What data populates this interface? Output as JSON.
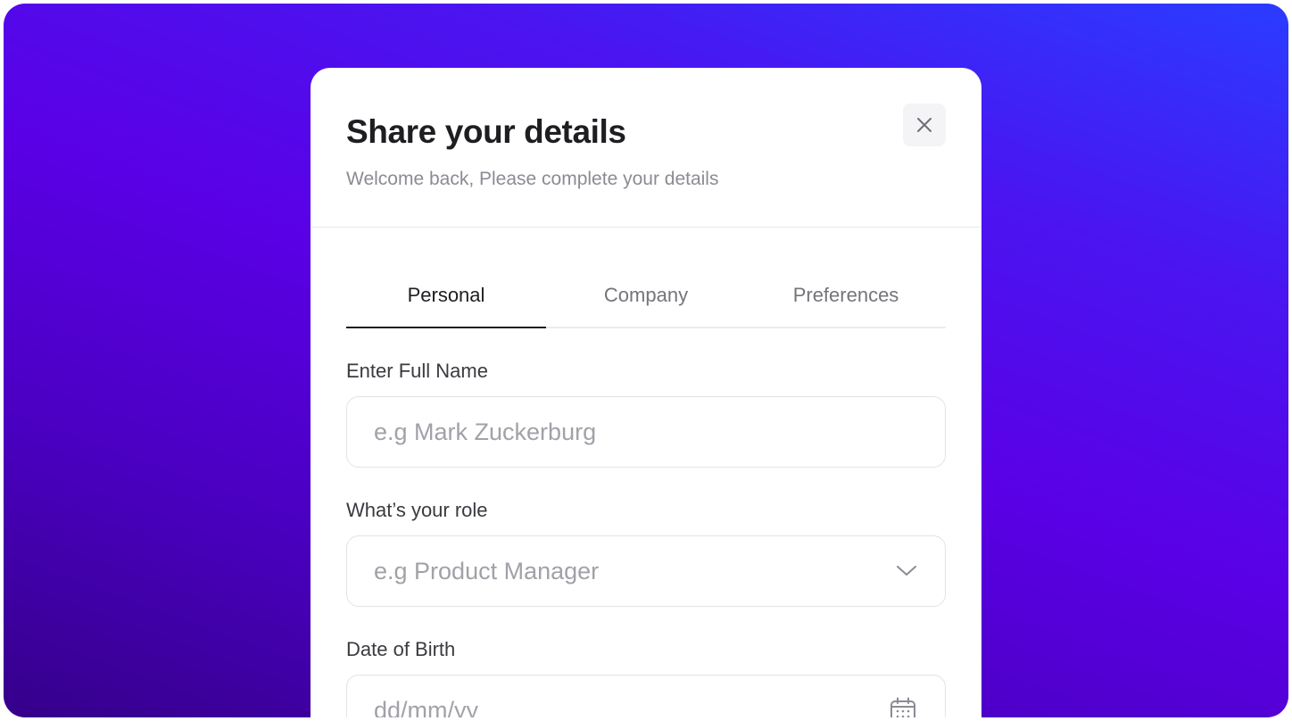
{
  "modal": {
    "title": "Share your details",
    "subtitle": "Welcome back, Please complete your details",
    "close_icon": "close-icon"
  },
  "tabs": [
    {
      "label": "Personal",
      "active": true
    },
    {
      "label": "Company",
      "active": false
    },
    {
      "label": "Preferences",
      "active": false
    }
  ],
  "form": {
    "full_name": {
      "label": "Enter Full Name",
      "placeholder": "e.g Mark Zuckerburg",
      "value": ""
    },
    "role": {
      "label": "What’s your role",
      "placeholder": "e.g Product Manager",
      "icon": "chevron-down-icon"
    },
    "dob": {
      "label": "Date of Birth",
      "placeholder": "dd/mm/yy",
      "icon": "calendar-icon"
    }
  },
  "colors": {
    "gradient_top_right": "#2a3cff",
    "gradient_mid": "#5a00e6",
    "gradient_bottom_left": "#35008a",
    "title_text": "#1e1e22",
    "muted_text": "#8b8b93"
  }
}
